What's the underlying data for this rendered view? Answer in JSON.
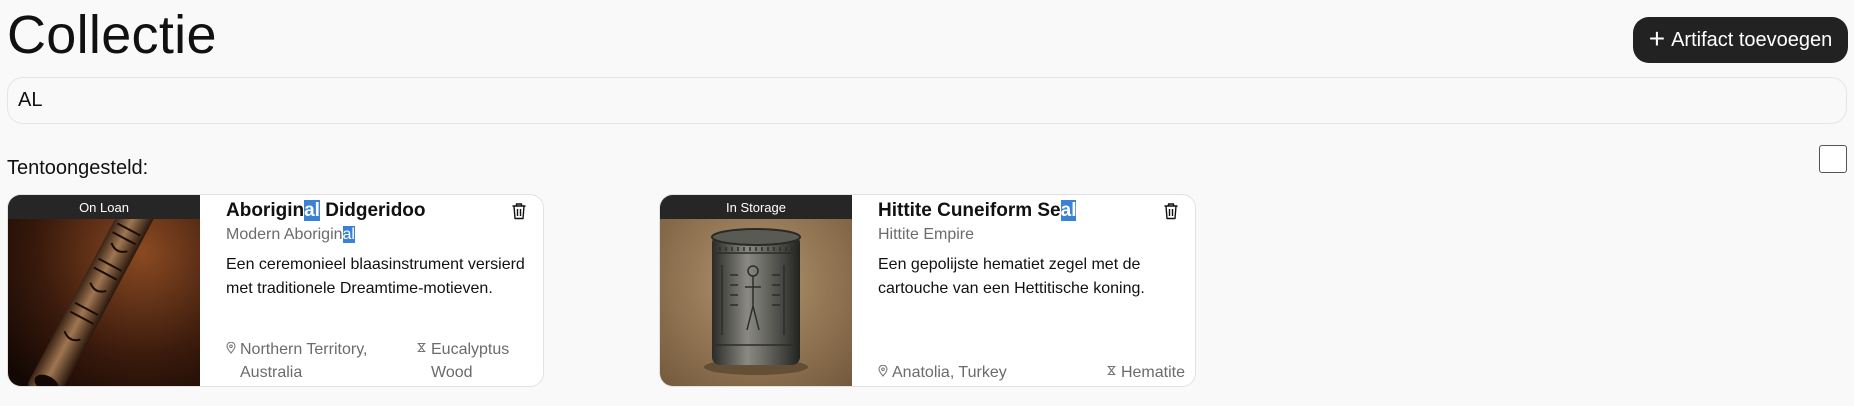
{
  "header": {
    "title": "Collectie",
    "add_button_label": "Artifact toevoegen"
  },
  "search": {
    "value": "AL",
    "placeholder": ""
  },
  "section": {
    "label": "Tentoongesteld:"
  },
  "artifacts": [
    {
      "status": "On Loan",
      "title_before": "Aborigin",
      "title_match": "al",
      "title_after": " Didgeridoo",
      "culture_before": "Modern Aborigin",
      "culture_match": "al",
      "culture_after": "",
      "description": "Een ceremonieel blaasinstrument versierd met traditionele Dreamtime-motieven.",
      "location": "Northern Territory, Australia",
      "material": "Eucalyptus Wood"
    },
    {
      "status": "In Storage",
      "title_before": "Hittite Cuneiform Se",
      "title_match": "al",
      "title_after": "",
      "culture_before": "Hittite Empire",
      "culture_match": "",
      "culture_after": "",
      "description": "Een gepolijste hematiet zegel met de cartouche van een Hettitische koning.",
      "location": "Anatolia, Turkey",
      "material": "Hematite"
    }
  ],
  "colors": {
    "accent": "#222222",
    "highlight": "#3b82d6",
    "badge": "#262626"
  },
  "icons": {
    "add": "plus-icon",
    "delete": "trash-icon",
    "location": "map-pin-icon",
    "material": "hourglass-icon"
  }
}
